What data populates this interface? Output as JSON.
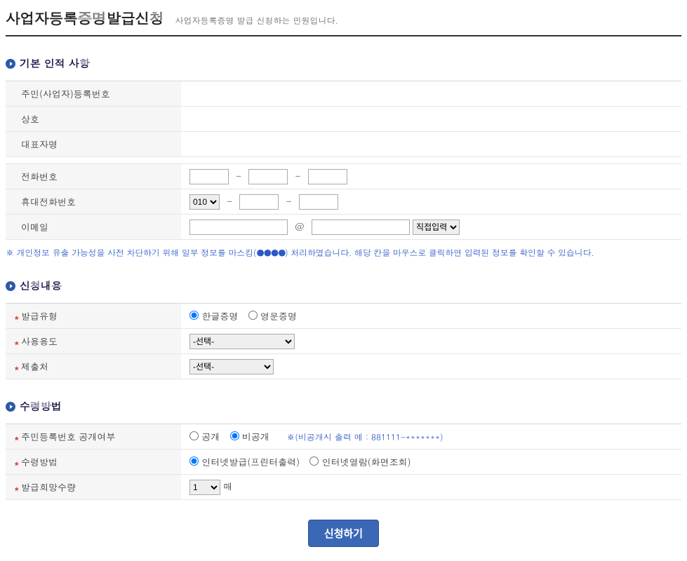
{
  "header": {
    "title": "사업자등록증명발급신청",
    "subtitle": "사업자등록증명 발급 신청하는 민원입니다."
  },
  "sections": {
    "personal": "기본 인적 사항",
    "request": "신청내용",
    "receive": "수령방법"
  },
  "personal_fields": {
    "reg_no_label": "주민(사업자)등록번호",
    "reg_no_value": "",
    "trade_name_label": "상호",
    "rep_name_label": "대표자명",
    "phone_label": "전화번호",
    "mobile_label": "휴대전화번호",
    "mobile_prefix": "010",
    "email_label": "이메일",
    "email_domain_placeholder": "직접입력"
  },
  "hint": {
    "prefix": "※ 개인정보 유출 가능성을 사전 차단하기 위해 일부 정보를 마스킹(",
    "bullets": "●●●●",
    "suffix": ") 처리하였습니다. 해당 칸을 마우스로 클릭하면 입력된 정보를 확인할 수 있습니다."
  },
  "request_fields": {
    "type_label": "발급유형",
    "type_opt1": "한글증명",
    "type_opt2": "영문증명",
    "usage_label": "사용용도",
    "usage_placeholder": "-선택-",
    "submit_to_label": "제출처",
    "submit_to_placeholder": "-선택-"
  },
  "receive_fields": {
    "ssn_public_label": "주민등록번호 공개여부",
    "ssn_opt1": "공개",
    "ssn_opt2": "비공개",
    "ssn_note": "※(비공개시 출력 예 : 881111-*******)",
    "method_label": "수령방법",
    "method_opt1": "인터넷발급(프린터출력)",
    "method_opt2": "인터넷열람(화면조회)",
    "qty_label": "발급희망수량",
    "qty_value": "1",
    "qty_unit": "매"
  },
  "actions": {
    "submit": "신청하기"
  }
}
